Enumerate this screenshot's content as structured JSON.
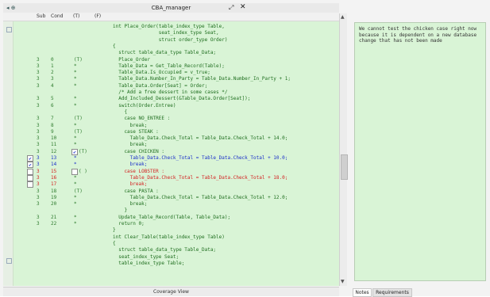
{
  "window": {
    "title": "CBA_manager",
    "left_control": "◂ ⊕"
  },
  "columns": {
    "sub": "Sub",
    "cond": "Cond",
    "t_col": "(T)",
    "f_col": "(F)"
  },
  "code_rows": [
    {
      "sub": "",
      "cond": "",
      "tf": "",
      "code": "int Place_Order(table_index_type Table,",
      "state": "normal",
      "check": "",
      "check2": ""
    },
    {
      "sub": "",
      "cond": "",
      "tf": "",
      "code": "                seat_index_type Seat,",
      "state": "normal",
      "check": "",
      "check2": ""
    },
    {
      "sub": "",
      "cond": "",
      "tf": "",
      "code": "                struct order_type Order)",
      "state": "normal",
      "check": "",
      "check2": ""
    },
    {
      "sub": "",
      "cond": "",
      "tf": "",
      "code": "{",
      "state": "normal",
      "check": "",
      "check2": ""
    },
    {
      "sub": "",
      "cond": "",
      "tf": "",
      "code": "  struct table_data_type Table_Data;",
      "state": "normal",
      "check": "",
      "check2": ""
    },
    {
      "sub": "3",
      "cond": "0",
      "tf": "(T)",
      "code": "  Place_Order",
      "state": "normal",
      "check": "",
      "check2": ""
    },
    {
      "sub": "3",
      "cond": "1",
      "tf": "*",
      "code": "  Table_Data = Get_Table_Record(Table);",
      "state": "normal",
      "check": "",
      "check2": ""
    },
    {
      "sub": "3",
      "cond": "2",
      "tf": "*",
      "code": "  Table_Data.Is_Occupied = v_true;",
      "state": "normal",
      "check": "",
      "check2": ""
    },
    {
      "sub": "3",
      "cond": "3",
      "tf": "*",
      "code": "  Table_Data.Number_In_Party = Table_Data.Number_In_Party + 1;",
      "state": "normal",
      "check": "",
      "check2": ""
    },
    {
      "sub": "3",
      "cond": "4",
      "tf": "*",
      "code": "  Table_Data.Order[Seat] = Order;",
      "state": "normal",
      "check": "",
      "check2": ""
    },
    {
      "sub": "",
      "cond": "",
      "tf": "",
      "code": "  /* Add a free dessert in some cases */",
      "state": "normal",
      "check": "",
      "check2": ""
    },
    {
      "sub": "3",
      "cond": "5",
      "tf": "*",
      "code": "  Add_Included_Dessert(&Table_Data.Order[Seat]);",
      "state": "normal",
      "check": "",
      "check2": ""
    },
    {
      "sub": "3",
      "cond": "6",
      "tf": "*",
      "code": "  switch(Order.Entree)",
      "state": "normal",
      "check": "",
      "check2": ""
    },
    {
      "sub": "",
      "cond": "",
      "tf": "",
      "code": "    {",
      "state": "normal",
      "check": "",
      "check2": ""
    },
    {
      "sub": "3",
      "cond": "7",
      "tf": "(T)",
      "code": "    case NO_ENTREE :",
      "state": "normal",
      "check": "",
      "check2": ""
    },
    {
      "sub": "3",
      "cond": "8",
      "tf": "*",
      "code": "      break;",
      "state": "normal",
      "check": "",
      "check2": ""
    },
    {
      "sub": "3",
      "cond": "9",
      "tf": "(T)",
      "code": "    case STEAK :",
      "state": "normal",
      "check": "",
      "check2": ""
    },
    {
      "sub": "3",
      "cond": "10",
      "tf": "*",
      "code": "      Table_Data.Check_Total = Table_Data.Check_Total + 14.0;",
      "state": "normal",
      "check": "",
      "check2": ""
    },
    {
      "sub": "3",
      "cond": "11",
      "tf": "*",
      "code": "      break;",
      "state": "normal",
      "check": "",
      "check2": ""
    },
    {
      "sub": "3",
      "cond": "12",
      "tf": "(T)",
      "code": "    case CHICKEN :",
      "state": "normal",
      "check": "",
      "check2": "✔"
    },
    {
      "sub": "3",
      "cond": "13",
      "tf": "*",
      "code": "      Table_Data.Check_Total = Table_Data.Check_Total + 10.0;",
      "state": "blue",
      "check": "✔",
      "check2": ""
    },
    {
      "sub": "3",
      "cond": "14",
      "tf": "*",
      "code": "      break;",
      "state": "blue",
      "check": "✔",
      "check2": ""
    },
    {
      "sub": "3",
      "cond": "15",
      "tf": "( )",
      "code": "    case LOBSTER :",
      "state": "red",
      "check": " ",
      "check2": " "
    },
    {
      "sub": "3",
      "cond": "16",
      "tf": "*",
      "code": "      Table_Data.Check_Total = Table_Data.Check_Total + 18.0;",
      "state": "red",
      "check": " ",
      "check2": ""
    },
    {
      "sub": "3",
      "cond": "17",
      "tf": "*",
      "code": "      break;",
      "state": "red",
      "check": " ",
      "check2": ""
    },
    {
      "sub": "3",
      "cond": "18",
      "tf": "(T)",
      "code": "    case PASTA :",
      "state": "normal",
      "check": "",
      "check2": ""
    },
    {
      "sub": "3",
      "cond": "19",
      "tf": "*",
      "code": "      Table_Data.Check_Total = Table_Data.Check_Total + 12.0;",
      "state": "normal",
      "check": "",
      "check2": ""
    },
    {
      "sub": "3",
      "cond": "20",
      "tf": "*",
      "code": "      break;",
      "state": "normal",
      "check": "",
      "check2": ""
    },
    {
      "sub": "",
      "cond": "",
      "tf": "",
      "code": "    }",
      "state": "normal",
      "check": "",
      "check2": ""
    },
    {
      "sub": "3",
      "cond": "21",
      "tf": "*",
      "code": "  Update_Table_Record(Table, Table_Data);",
      "state": "normal",
      "check": "",
      "check2": ""
    },
    {
      "sub": "3",
      "cond": "22",
      "tf": "*",
      "code": "  return 0;",
      "state": "normal",
      "check": "",
      "check2": ""
    },
    {
      "sub": "",
      "cond": "",
      "tf": "",
      "code": "}",
      "state": "normal",
      "check": "",
      "check2": ""
    },
    {
      "sub": "",
      "cond": "",
      "tf": "",
      "code": "int Clear_Table(table_index_type Table)",
      "state": "normal",
      "check": "",
      "check2": ""
    },
    {
      "sub": "",
      "cond": "",
      "tf": "",
      "code": "{",
      "state": "normal",
      "check": "",
      "check2": ""
    },
    {
      "sub": "",
      "cond": "",
      "tf": "",
      "code": "  struct table_data_type Table_Data;",
      "state": "normal",
      "check": "",
      "check2": ""
    },
    {
      "sub": "",
      "cond": "",
      "tf": "",
      "code": "  seat_index_type Seat;",
      "state": "normal",
      "check": "",
      "check2": ""
    },
    {
      "sub": "",
      "cond": "",
      "tf": "",
      "code": "  table_index_type Table;",
      "state": "normal",
      "check": "",
      "check2": ""
    }
  ],
  "coverage_tab": "Coverage View",
  "notes_text": "We cannot test the chicken case right now because it is dependent on a new database change that has not been made",
  "side_tabs": {
    "notes": "Notes",
    "requirements": "Requirements"
  },
  "colors": {
    "pane_bg": "#d9f4d6",
    "covered": "#1a2fc9",
    "uncovered": "#d42020",
    "normal": "#1f6e1f"
  }
}
